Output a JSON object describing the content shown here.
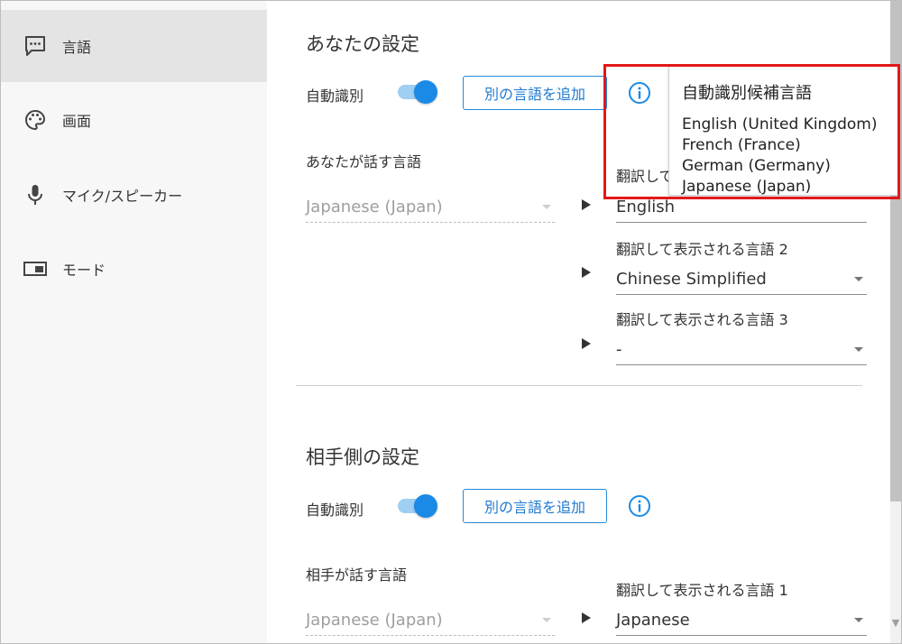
{
  "sidebar": {
    "items": [
      {
        "label": "言語",
        "icon": "chat-bubble-icon",
        "active": true
      },
      {
        "label": "画面",
        "icon": "palette-icon",
        "active": false
      },
      {
        "label": "マイク/スピーカー",
        "icon": "microphone-icon",
        "active": false
      },
      {
        "label": "モード",
        "icon": "display-mode-icon",
        "active": false
      }
    ]
  },
  "your_settings": {
    "title": "あなたの設定",
    "auto_detect_label": "自動識別",
    "add_language_button": "別の言語を追加",
    "speak_language_label": "あなたが話す言語",
    "speak_language_value": "Japanese (Japan)",
    "translations": [
      {
        "label": "翻訳して",
        "value": "English"
      },
      {
        "label": "翻訳して表示される言語 2",
        "value": "Chinese Simplified"
      },
      {
        "label": "翻訳して表示される言語 3",
        "value": "-"
      }
    ]
  },
  "partner_settings": {
    "title": "相手側の設定",
    "auto_detect_label": "自動識別",
    "add_language_button": "別の言語を追加",
    "speak_language_label": "相手が話す言語",
    "speak_language_value": "Japanese (Japan)",
    "translations": [
      {
        "label": "翻訳して表示される言語 1",
        "value": "Japanese"
      }
    ]
  },
  "tooltip": {
    "title": "自動識別候補言語",
    "languages": [
      "English (United Kingdom)",
      "French (France)",
      "German (Germany)",
      "Japanese (Japan)"
    ]
  },
  "colors": {
    "accent": "#1a8ae6",
    "highlight": "#e31818",
    "sidebar_active": "#e4e4e4"
  }
}
